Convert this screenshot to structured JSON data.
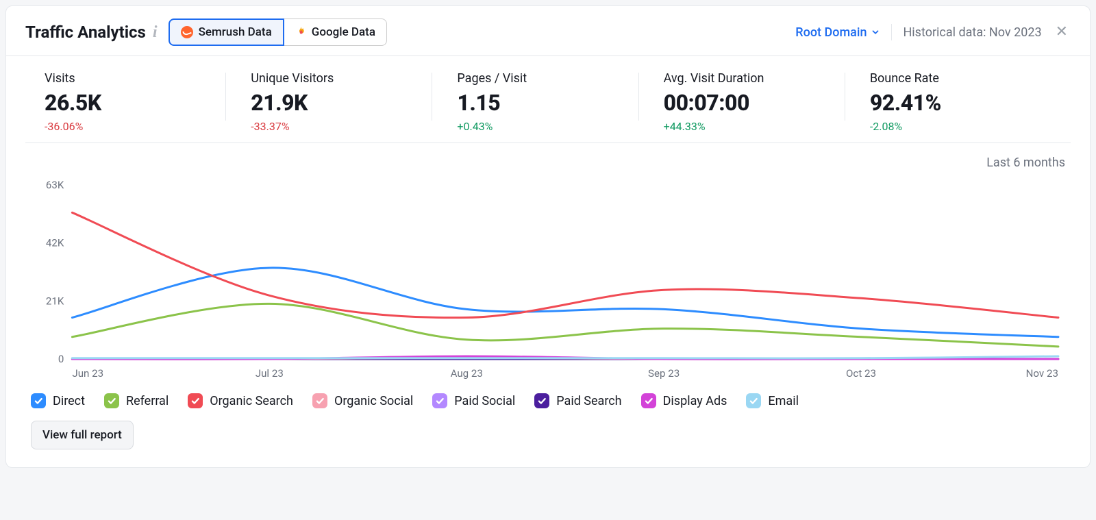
{
  "header": {
    "title": "Traffic Analytics",
    "tabs": {
      "semrush": "Semrush Data",
      "google": "Google Data"
    },
    "scope": "Root Domain",
    "historical_label": "Historical data: Nov 2023"
  },
  "metrics": [
    {
      "label": "Visits",
      "value": "26.5K",
      "delta": "-36.06%",
      "dir": "neg"
    },
    {
      "label": "Unique Visitors",
      "value": "21.9K",
      "delta": "-33.37%",
      "dir": "neg"
    },
    {
      "label": "Pages / Visit",
      "value": "1.15",
      "delta": "+0.43%",
      "dir": "pos"
    },
    {
      "label": "Avg. Visit Duration",
      "value": "00:07:00",
      "delta": "+44.33%",
      "dir": "pos"
    },
    {
      "label": "Bounce Rate",
      "value": "92.41%",
      "delta": "-2.08%",
      "dir": "pos"
    }
  ],
  "range_label": "Last 6 months",
  "legend": [
    {
      "name": "Direct",
      "color": "#2D8CFF"
    },
    {
      "name": "Referral",
      "color": "#8BC34A"
    },
    {
      "name": "Organic Search",
      "color": "#F04B54"
    },
    {
      "name": "Organic Social",
      "color": "#F7A1B0"
    },
    {
      "name": "Paid Social",
      "color": "#B388FF"
    },
    {
      "name": "Paid Search",
      "color": "#4B1E9E"
    },
    {
      "name": "Display Ads",
      "color": "#D343D8"
    },
    {
      "name": "Email",
      "color": "#9AD7F3"
    }
  ],
  "footer": {
    "view_full": "View full report"
  },
  "chart_data": {
    "type": "line",
    "title": "",
    "xlabel": "",
    "ylabel": "",
    "ylim": [
      0,
      63000
    ],
    "y_ticks": [
      0,
      21000,
      42000,
      63000
    ],
    "y_tick_labels": [
      "0",
      "21K",
      "42K",
      "63K"
    ],
    "categories": [
      "Jun 23",
      "Jul 23",
      "Aug 23",
      "Sep 23",
      "Oct 23",
      "Nov 23"
    ],
    "series": [
      {
        "name": "Direct",
        "color": "#2D8CFF",
        "values": [
          15000,
          33000,
          18000,
          18000,
          11000,
          8000
        ]
      },
      {
        "name": "Referral",
        "color": "#8BC34A",
        "values": [
          8000,
          20000,
          7000,
          11000,
          8000,
          4500
        ]
      },
      {
        "name": "Organic Search",
        "color": "#F04B54",
        "values": [
          53000,
          23000,
          15000,
          25000,
          22000,
          15000
        ]
      },
      {
        "name": "Organic Social",
        "color": "#F7A1B0",
        "values": [
          0,
          0,
          500,
          0,
          0,
          0
        ]
      },
      {
        "name": "Paid Social",
        "color": "#B388FF",
        "values": [
          0,
          0,
          0,
          0,
          0,
          0
        ]
      },
      {
        "name": "Paid Search",
        "color": "#4B1E9E",
        "values": [
          0,
          0,
          0,
          0,
          0,
          0
        ]
      },
      {
        "name": "Display Ads",
        "color": "#D343D8",
        "values": [
          0,
          0,
          1000,
          0,
          0,
          0
        ]
      },
      {
        "name": "Email",
        "color": "#9AD7F3",
        "values": [
          300,
          300,
          300,
          300,
          300,
          1000
        ]
      }
    ]
  }
}
